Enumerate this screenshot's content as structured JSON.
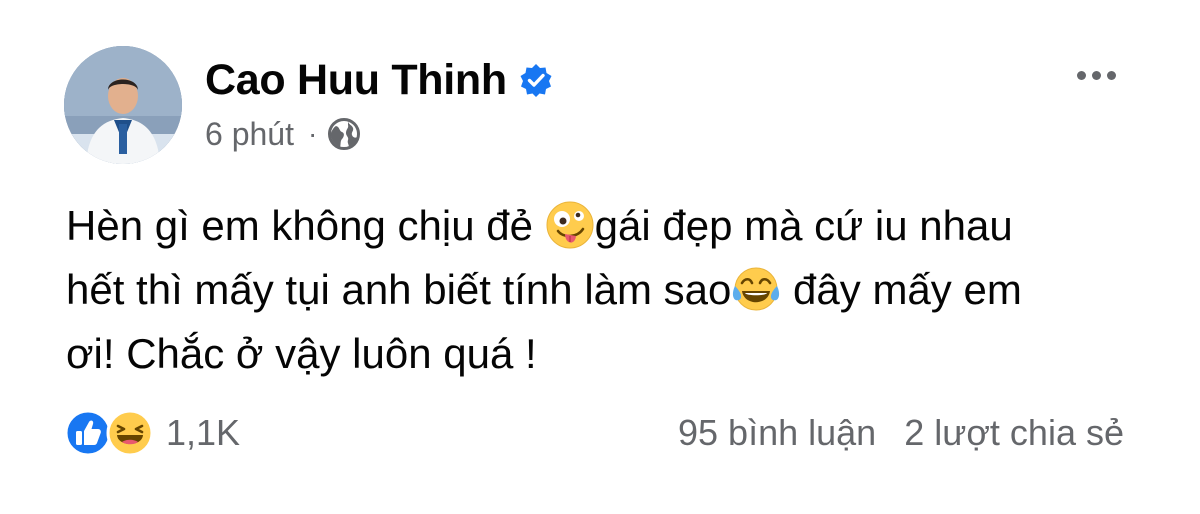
{
  "post": {
    "author": "Cao Huu Thinh",
    "time": "6 phút",
    "separator": "·",
    "text": {
      "line1_a": "Hèn gì em không chịu đẻ ",
      "line1_b": "gái đẹp mà cứ iu nhau",
      "line2_a": "hết thì mấy tụi anh biết tính làm sao",
      "line2_b": " đây mấy em",
      "line3": "ơi! Chắc ở vậy luôn quá !"
    },
    "reaction_count": "1,1K",
    "comments": "95 bình luận",
    "shares": "2 lượt chia sẻ"
  },
  "icons": {
    "verified": "verified-badge-icon",
    "audience": "globe-icon",
    "more": "more-options-icon",
    "emoji_1": "zany-face-emoji",
    "emoji_2": "tears-of-joy-emoji",
    "reaction_1": "like-icon",
    "reaction_2": "haha-icon"
  },
  "colors": {
    "brand_blue": "#1877f2",
    "text_primary": "#050505",
    "text_secondary": "#65676b",
    "emoji_yellow": "#ffcc4d"
  }
}
